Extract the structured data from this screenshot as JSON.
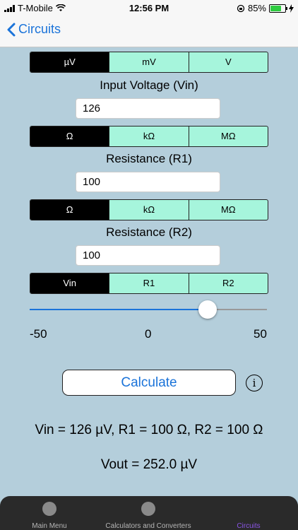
{
  "status": {
    "carrier": "T-Mobile",
    "time": "12:56 PM",
    "battery": "85%",
    "battery_level": 0.85
  },
  "nav": {
    "back_label": "Circuits"
  },
  "voltage_units": {
    "options": [
      "µV",
      "mV",
      "V"
    ],
    "selected": 0
  },
  "vin": {
    "label": "Input Voltage (Vin)",
    "value": "126"
  },
  "r1_units": {
    "options": [
      "Ω",
      "kΩ",
      "MΩ"
    ],
    "selected": 0
  },
  "r1": {
    "label": "Resistance (R1)",
    "value": "100"
  },
  "r2_units": {
    "options": [
      "Ω",
      "kΩ",
      "MΩ"
    ],
    "selected": 0
  },
  "r2": {
    "label": "Resistance (R2)",
    "value": "100"
  },
  "target": {
    "options": [
      "Vin",
      "R1",
      "R2"
    ],
    "selected": 0
  },
  "slider": {
    "min": "-50",
    "mid": "0",
    "max": "50",
    "value": 25
  },
  "calculate_label": "Calculate",
  "info_glyph": "i",
  "results": {
    "line1": "Vin = 126 µV, R1 = 100 Ω, R2 = 100 Ω",
    "line2": "Vout = 252.0 µV"
  },
  "tabs": [
    {
      "label": "Main Menu"
    },
    {
      "label": "Calculators and Converters"
    },
    {
      "label": "Circuits"
    }
  ],
  "colors": {
    "accent": "#1a73d9",
    "segment": "#a6f5dc",
    "background": "#b4cedb",
    "active_tab": "#8b55e6"
  }
}
